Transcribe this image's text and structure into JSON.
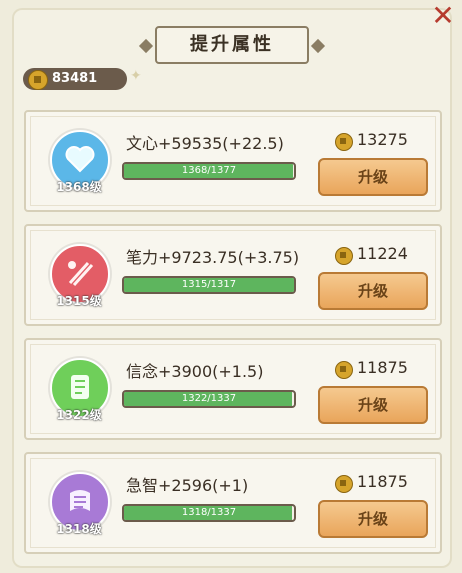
{
  "title": "提升属性",
  "currency": {
    "value": "83481"
  },
  "attributes": [
    {
      "name": "文心+59535(+22.5)",
      "level": "1368级",
      "progress": "1368/1377",
      "progress_fraction": 0.9935,
      "cost": "13275",
      "button": "升级",
      "icon": "heart-icon",
      "color": "#5bb7e8"
    },
    {
      "name": "笔力+9723.75(+3.75)",
      "level": "1315级",
      "progress": "1315/1317",
      "progress_fraction": 0.9985,
      "cost": "11224",
      "button": "升级",
      "icon": "brush-icon",
      "color": "#e35d66"
    },
    {
      "name": "信念+3900(+1.5)",
      "level": "1322级",
      "progress": "1322/1337",
      "progress_fraction": 0.9888,
      "cost": "11875",
      "button": "升级",
      "icon": "scroll-icon",
      "color": "#6fcf5a"
    },
    {
      "name": "急智+2596(+1)",
      "level": "1318级",
      "progress": "1318/1337",
      "progress_fraction": 0.9858,
      "cost": "11875",
      "button": "升级",
      "icon": "scroll-icon",
      "color": "#a87ad6"
    }
  ]
}
